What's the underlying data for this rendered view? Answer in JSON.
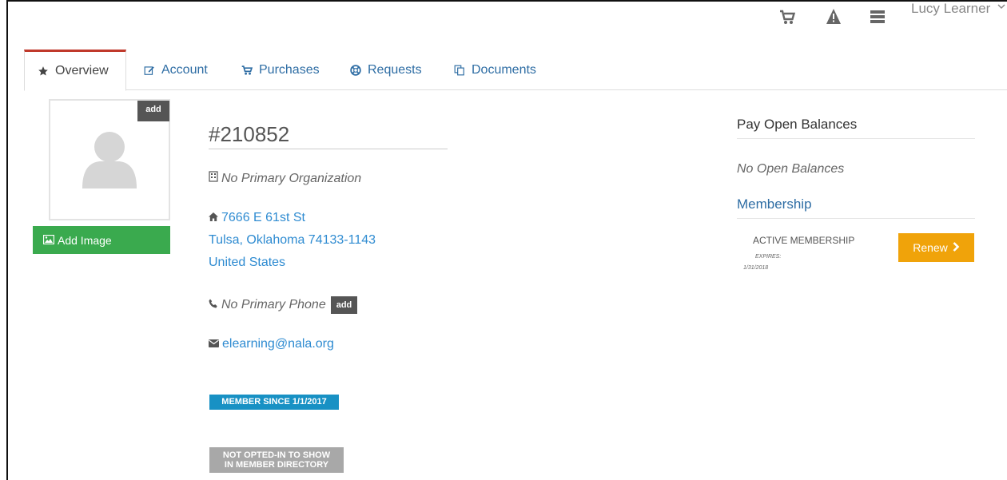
{
  "header": {
    "user_name": "Lucy Learner",
    "icons": [
      "cart-icon",
      "alert-icon",
      "list-icon"
    ]
  },
  "tabs": [
    {
      "label": "Overview",
      "icon": "star-icon",
      "active": true
    },
    {
      "label": "Account",
      "icon": "edit-icon",
      "active": false
    },
    {
      "label": "Purchases",
      "icon": "cart-icon",
      "active": false
    },
    {
      "label": "Requests",
      "icon": "lifebuoy-icon",
      "active": false
    },
    {
      "label": "Documents",
      "icon": "copy-icon",
      "active": false
    }
  ],
  "avatar": {
    "add_label": "add",
    "add_image_label": "Add Image"
  },
  "profile": {
    "member_id": "#210852",
    "organization": "No Primary Organization",
    "address_line1": "7666 E 61st St",
    "address_line2": "Tulsa, Oklahoma 74133-1143",
    "address_line3": "United States",
    "phone": "No Primary Phone",
    "phone_add_label": "add",
    "email": "elearning@nala.org",
    "member_since_badge": "MEMBER SINCE 1/1/2017",
    "directory_badge_line1": "NOT OPTED-IN TO SHOW",
    "directory_badge_line2": "IN MEMBER DIRECTORY"
  },
  "balances": {
    "title": "Pay Open Balances",
    "empty_text": "No Open Balances"
  },
  "membership": {
    "title": "Membership",
    "status": "ACTIVE MEMBERSHIP",
    "expires_label": "EXPIRES:",
    "expires_date": "1/31/2018",
    "renew_label": "Renew"
  },
  "colors": {
    "accent_red": "#c0392b",
    "link_blue": "#2e8bd1",
    "add_image_green": "#3aaa4e",
    "renew_orange": "#f0a30a",
    "badge_blue": "#1891c4",
    "badge_gray": "#a8a8a8"
  }
}
